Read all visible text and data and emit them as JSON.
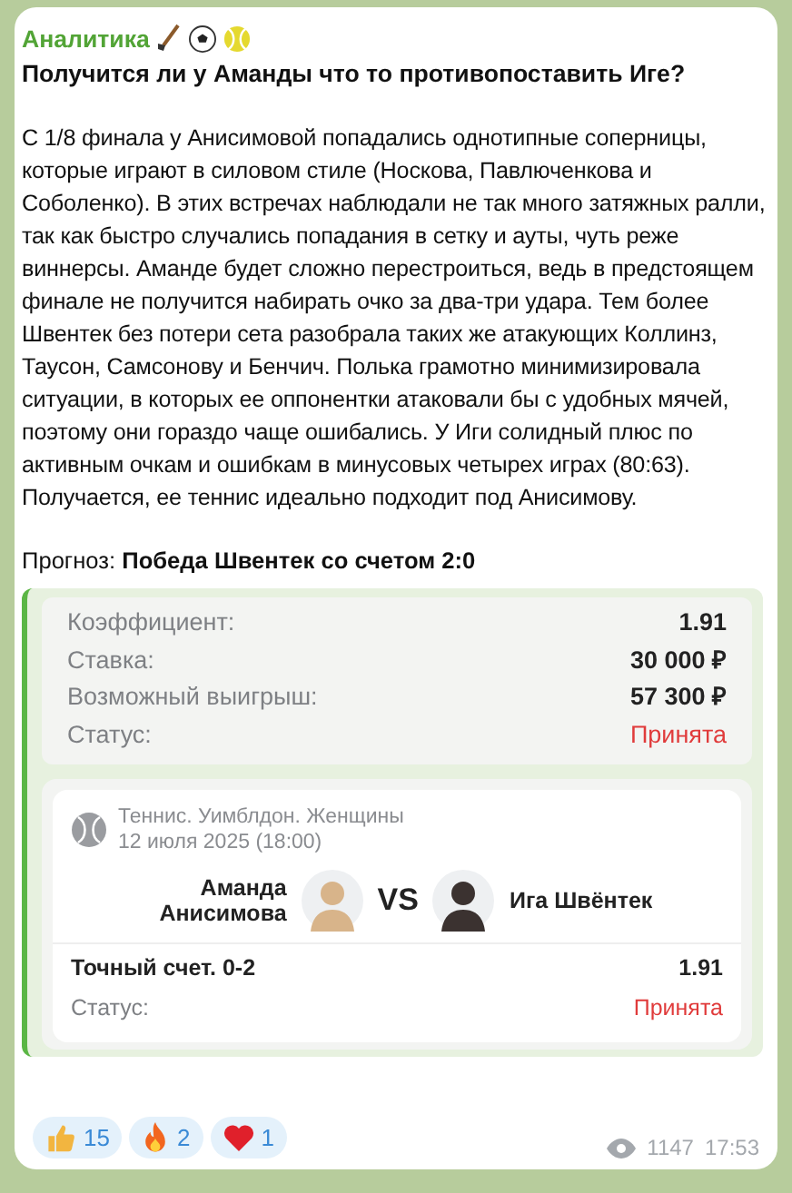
{
  "message": {
    "sender": "Аналитика",
    "title": "Получится ли у Аманды что то противопоставить Иге?",
    "body": "С 1/8 финала у Анисимовой попадались однотипные соперницы, которые играют в силовом стиле (Носкова, Павлюченкова и Соболенко). В этих встречах наблюдали не так много затяжных ралли, так как быстро случались попадания в сетку и ауты, чуть реже виннерсы. Аманде будет сложно перестроиться, ведь в предстоящем финале не получится набирать очко за два-три удара. Тем более Швентек без потери сета разобрала таких же атакующих Коллинз, Таусон, Самсонову и Бенчич. Полька грамотно минимизировала ситуации, в которых ее оппонентки атаковали бы с удобных мячей, поэтому они гораздо чаще ошибались. У Иги солидный плюс по активным очкам и ошибкам в минусовых четырех играх (80:63). Получается, ее теннис идеально подходит под Анисимову.",
    "forecast": "Прогноз: **Победа Швентек со счетом 2:0**"
  },
  "bet": {
    "rows": [
      {
        "label": "Коэффициент:",
        "value": "1.91",
        "kind": "plain"
      },
      {
        "label": "Ставка:",
        "value": "30 000 ₽",
        "kind": "plain"
      },
      {
        "label": "Возможный выигрыш:",
        "value": "57 300 ₽",
        "kind": "plain"
      },
      {
        "label": "Статус:",
        "value": "Принята",
        "kind": "status"
      }
    ],
    "match": {
      "league": "Теннис. Уимблдон. Женщины",
      "date": "12 июля 2025 (18:00)",
      "home": "Аманда Анисимова",
      "vs": "VS",
      "away": "Ига Швёнтек",
      "market": "Точный счет. 0-2",
      "odds": "1.91",
      "status_label": "Статус:",
      "status": "Принята"
    }
  },
  "reactions": [
    {
      "kind": "like",
      "count": "15"
    },
    {
      "kind": "fire",
      "count": "2"
    },
    {
      "kind": "heart",
      "count": "1"
    }
  ],
  "views": "1147",
  "time": "17:53"
}
